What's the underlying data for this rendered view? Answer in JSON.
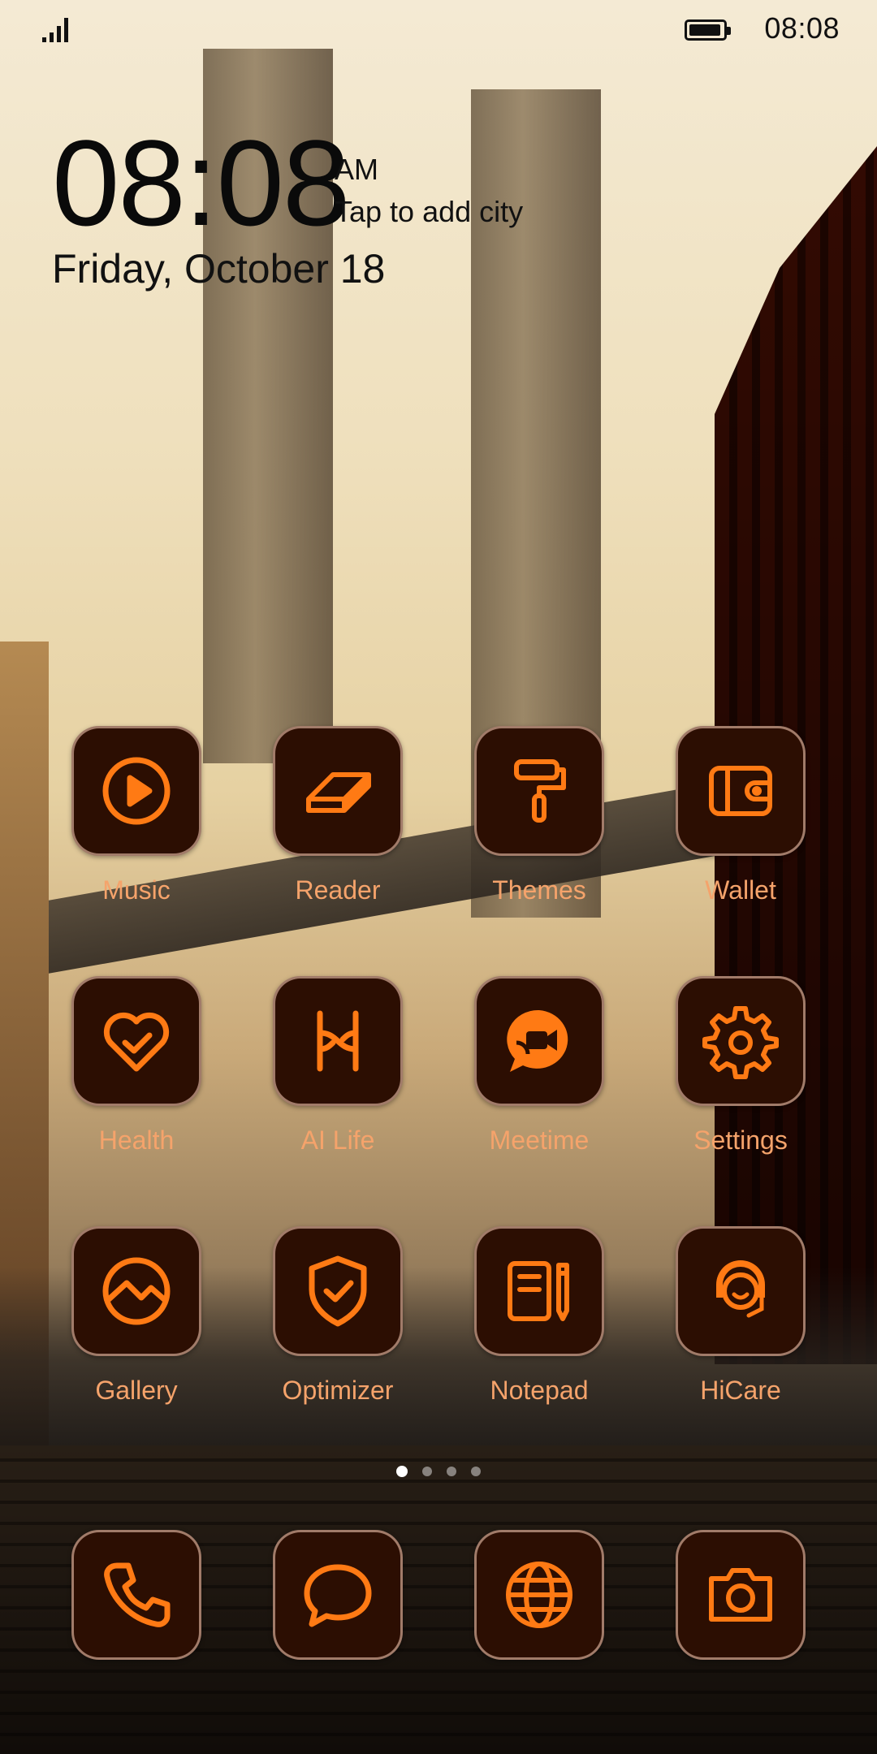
{
  "status_bar": {
    "time": "08:08",
    "battery_level": 0.95,
    "signal_bars": 4
  },
  "clock_widget": {
    "time": "08:08",
    "ampm": "AM",
    "city": "Tap to add city",
    "date": "Friday, October 18"
  },
  "theme": {
    "icon_fg": "#ff7a14",
    "icon_bg": "#2c0e02",
    "label_color": "#f5a36b"
  },
  "apps": [
    {
      "label": "Music",
      "icon": "play-circle-icon"
    },
    {
      "label": "Reader",
      "icon": "book-icon"
    },
    {
      "label": "Themes",
      "icon": "paint-roller-icon"
    },
    {
      "label": "Wallet",
      "icon": "wallet-icon"
    },
    {
      "label": "Health",
      "icon": "heart-check-icon"
    },
    {
      "label": "AI Life",
      "icon": "ai-life-icon"
    },
    {
      "label": "Meetime",
      "icon": "video-chat-icon"
    },
    {
      "label": "Settings",
      "icon": "gear-icon"
    },
    {
      "label": "Gallery",
      "icon": "gallery-icon"
    },
    {
      "label": "Optimizer",
      "icon": "shield-check-icon"
    },
    {
      "label": "Notepad",
      "icon": "notepad-icon"
    },
    {
      "label": "HiCare",
      "icon": "headset-icon"
    }
  ],
  "dock": [
    {
      "icon": "phone-icon"
    },
    {
      "icon": "message-icon"
    },
    {
      "icon": "globe-icon"
    },
    {
      "icon": "camera-icon"
    }
  ],
  "page_indicator": {
    "pages": 4,
    "current": 1
  }
}
